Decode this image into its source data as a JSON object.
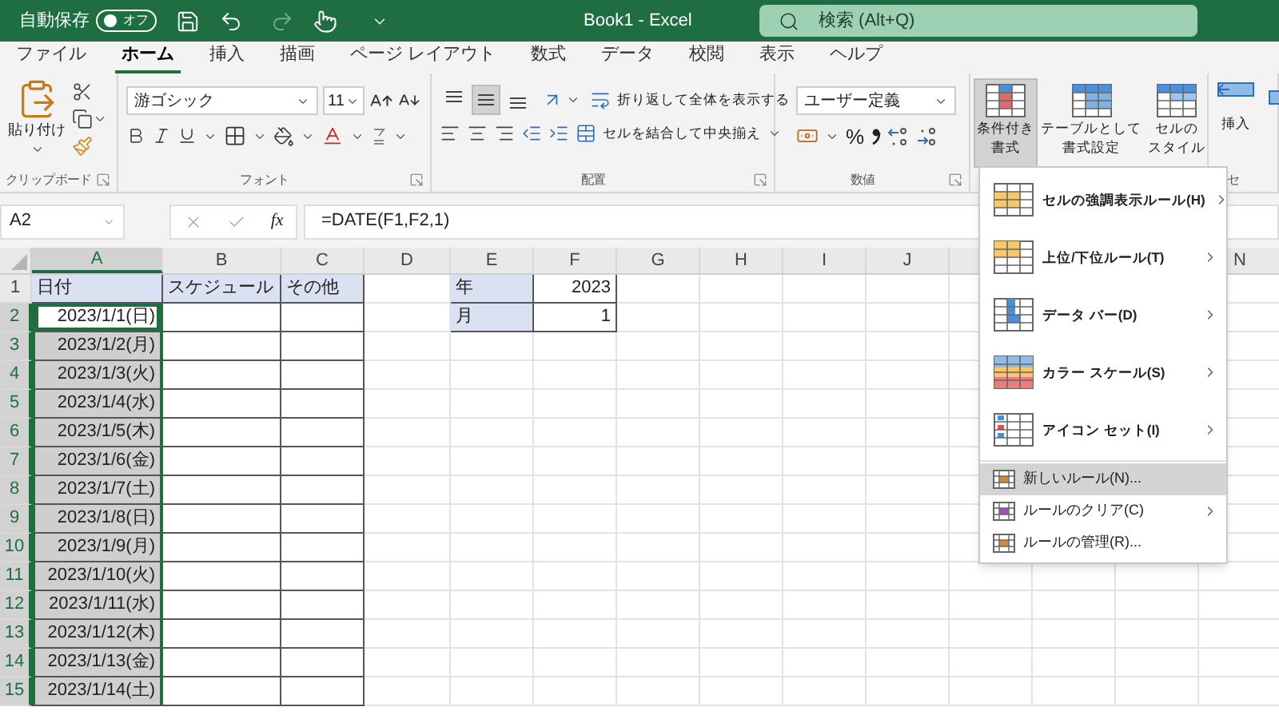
{
  "title_bar": {
    "autosave_label": "自動保存",
    "autosave_toggle": {
      "label": "オフ",
      "on": false
    },
    "title": "Book1 - Excel",
    "search": {
      "placeholder": "検索 (Alt+Q)"
    }
  },
  "tabs": [
    {
      "label": "ファイル",
      "selected": false
    },
    {
      "label": "ホーム",
      "selected": true
    },
    {
      "label": "挿入",
      "selected": false
    },
    {
      "label": "描画",
      "selected": false
    },
    {
      "label": "ページ レイアウト",
      "selected": false
    },
    {
      "label": "数式",
      "selected": false
    },
    {
      "label": "データ",
      "selected": false
    },
    {
      "label": "校閲",
      "selected": false
    },
    {
      "label": "表示",
      "selected": false
    },
    {
      "label": "ヘルプ",
      "selected": false
    }
  ],
  "ribbon": {
    "clipboard": {
      "paste_label": "貼り付け",
      "group_label": "クリップボード"
    },
    "font": {
      "font_name": "游ゴシック",
      "font_size": "11",
      "group_label": "フォント"
    },
    "alignment": {
      "vertical_buttons": [
        {
          "selected": false
        },
        {
          "selected": true
        },
        {
          "selected": false
        }
      ],
      "wrap_label": "折り返して全体を表示する",
      "merge_label": "セルを結合して中央揃え",
      "group_label": "配置"
    },
    "number": {
      "format": "ユーザー定義",
      "percent_label": "%",
      "group_label": "数値"
    },
    "styles": {
      "buttons": [
        {
          "lines": [
            "条件付き",
            "書式"
          ],
          "selected": true
        },
        {
          "lines": [
            "テーブルとして",
            "書式設定"
          ],
          "selected": false
        },
        {
          "lines": [
            "セルの",
            "スタイル"
          ],
          "selected": false
        }
      ]
    },
    "cells": {
      "insert_label": "挿入",
      "group_label": "セ"
    }
  },
  "formula_bar": {
    "name_box": "A2",
    "function_label": "fx",
    "formula": "=DATE(F1,F2,1)"
  },
  "sheet": {
    "columns": [
      {
        "label": "A",
        "selected": true
      },
      {
        "label": "B",
        "selected": false
      },
      {
        "label": "C",
        "selected": false
      },
      {
        "label": "D",
        "selected": false
      },
      {
        "label": "E",
        "selected": false
      },
      {
        "label": "F",
        "selected": false
      },
      {
        "label": "G",
        "selected": false
      },
      {
        "label": "H",
        "selected": false
      },
      {
        "label": "I",
        "selected": false
      },
      {
        "label": "J",
        "selected": false
      }
    ],
    "last_column": {
      "label": "N",
      "selected": false
    },
    "rows": [
      {
        "header": "1",
        "selected": false,
        "cells": [
          {
            "text": "日付",
            "kind": "text",
            "shaded": true,
            "bordered": true,
            "selected": false,
            "active": false
          },
          {
            "text": "スケジュール",
            "kind": "text",
            "shaded": true,
            "bordered": true,
            "selected": false,
            "active": false
          },
          {
            "text": "その他",
            "kind": "text",
            "shaded": true,
            "bordered": true,
            "selected": false,
            "active": false
          },
          {
            "kind": "empty",
            "shaded": false,
            "bordered": false,
            "selected": false,
            "active": false
          },
          {
            "text": "年",
            "kind": "text",
            "shaded": true,
            "bordered": true,
            "selected": false,
            "active": false
          },
          {
            "text": "2023",
            "kind": "number",
            "shaded": false,
            "bordered": true,
            "selected": false,
            "active": false
          }
        ]
      },
      {
        "header": "2",
        "selected": true,
        "cells": [
          {
            "text": "2023/1/1(日)",
            "kind": "number",
            "shaded": false,
            "bordered": true,
            "selected": true,
            "active": true
          },
          {
            "kind": "empty",
            "shaded": false,
            "bordered": true,
            "selected": false,
            "active": false
          },
          {
            "kind": "empty",
            "shaded": false,
            "bordered": true,
            "selected": false,
            "active": false
          },
          {
            "kind": "empty",
            "shaded": false,
            "bordered": false,
            "selected": false,
            "active": false
          },
          {
            "text": "月",
            "kind": "text",
            "shaded": true,
            "bordered": true,
            "selected": false,
            "active": false
          },
          {
            "text": "1",
            "kind": "number",
            "shaded": false,
            "bordered": true,
            "selected": false,
            "active": false
          }
        ]
      },
      {
        "header": "3",
        "selected": true,
        "cells": [
          {
            "text": "2023/1/2(月)",
            "kind": "number",
            "shaded": false,
            "bordered": true,
            "selected": true,
            "active": false
          },
          {
            "kind": "empty",
            "shaded": false,
            "bordered": true,
            "selected": false,
            "active": false
          },
          {
            "kind": "empty",
            "shaded": false,
            "bordered": true,
            "selected": false,
            "active": false
          }
        ]
      },
      {
        "header": "4",
        "selected": true,
        "cells": [
          {
            "text": "2023/1/3(火)",
            "kind": "number",
            "shaded": false,
            "bordered": true,
            "selected": true,
            "active": false
          },
          {
            "kind": "empty",
            "shaded": false,
            "bordered": true,
            "selected": false,
            "active": false
          },
          {
            "kind": "empty",
            "shaded": false,
            "bordered": true,
            "selected": false,
            "active": false
          }
        ]
      },
      {
        "header": "5",
        "selected": true,
        "cells": [
          {
            "text": "2023/1/4(水)",
            "kind": "number",
            "shaded": false,
            "bordered": true,
            "selected": true,
            "active": false
          },
          {
            "kind": "empty",
            "shaded": false,
            "bordered": true,
            "selected": false,
            "active": false
          },
          {
            "kind": "empty",
            "shaded": false,
            "bordered": true,
            "selected": false,
            "active": false
          }
        ]
      },
      {
        "header": "6",
        "selected": true,
        "cells": [
          {
            "text": "2023/1/5(木)",
            "kind": "number",
            "shaded": false,
            "bordered": true,
            "selected": true,
            "active": false
          },
          {
            "kind": "empty",
            "shaded": false,
            "bordered": true,
            "selected": false,
            "active": false
          },
          {
            "kind": "empty",
            "shaded": false,
            "bordered": true,
            "selected": false,
            "active": false
          }
        ]
      },
      {
        "header": "7",
        "selected": true,
        "cells": [
          {
            "text": "2023/1/6(金)",
            "kind": "number",
            "shaded": false,
            "bordered": true,
            "selected": true,
            "active": false
          },
          {
            "kind": "empty",
            "shaded": false,
            "bordered": true,
            "selected": false,
            "active": false
          },
          {
            "kind": "empty",
            "shaded": false,
            "bordered": true,
            "selected": false,
            "active": false
          }
        ]
      },
      {
        "header": "8",
        "selected": true,
        "cells": [
          {
            "text": "2023/1/7(土)",
            "kind": "number",
            "shaded": false,
            "bordered": true,
            "selected": true,
            "active": false
          },
          {
            "kind": "empty",
            "shaded": false,
            "bordered": true,
            "selected": false,
            "active": false
          },
          {
            "kind": "empty",
            "shaded": false,
            "bordered": true,
            "selected": false,
            "active": false
          }
        ]
      },
      {
        "header": "9",
        "selected": true,
        "cells": [
          {
            "text": "2023/1/8(日)",
            "kind": "number",
            "shaded": false,
            "bordered": true,
            "selected": true,
            "active": false
          },
          {
            "kind": "empty",
            "shaded": false,
            "bordered": true,
            "selected": false,
            "active": false
          },
          {
            "kind": "empty",
            "shaded": false,
            "bordered": true,
            "selected": false,
            "active": false
          }
        ]
      },
      {
        "header": "10",
        "selected": true,
        "cells": [
          {
            "text": "2023/1/9(月)",
            "kind": "number",
            "shaded": false,
            "bordered": true,
            "selected": true,
            "active": false
          },
          {
            "kind": "empty",
            "shaded": false,
            "bordered": true,
            "selected": false,
            "active": false
          },
          {
            "kind": "empty",
            "shaded": false,
            "bordered": true,
            "selected": false,
            "active": false
          }
        ]
      },
      {
        "header": "11",
        "selected": true,
        "cells": [
          {
            "text": "2023/1/10(火)",
            "kind": "number",
            "shaded": false,
            "bordered": true,
            "selected": true,
            "active": false
          },
          {
            "kind": "empty",
            "shaded": false,
            "bordered": true,
            "selected": false,
            "active": false
          },
          {
            "kind": "empty",
            "shaded": false,
            "bordered": true,
            "selected": false,
            "active": false
          }
        ]
      },
      {
        "header": "12",
        "selected": true,
        "cells": [
          {
            "text": "2023/1/11(水)",
            "kind": "number",
            "shaded": false,
            "bordered": true,
            "selected": true,
            "active": false
          },
          {
            "kind": "empty",
            "shaded": false,
            "bordered": true,
            "selected": false,
            "active": false
          },
          {
            "kind": "empty",
            "shaded": false,
            "bordered": true,
            "selected": false,
            "active": false
          }
        ]
      },
      {
        "header": "13",
        "selected": true,
        "cells": [
          {
            "text": "2023/1/12(木)",
            "kind": "number",
            "shaded": false,
            "bordered": true,
            "selected": true,
            "active": false
          },
          {
            "kind": "empty",
            "shaded": false,
            "bordered": true,
            "selected": false,
            "active": false
          },
          {
            "kind": "empty",
            "shaded": false,
            "bordered": true,
            "selected": false,
            "active": false
          }
        ]
      },
      {
        "header": "14",
        "selected": true,
        "cells": [
          {
            "text": "2023/1/13(金)",
            "kind": "number",
            "shaded": false,
            "bordered": true,
            "selected": true,
            "active": false
          },
          {
            "kind": "empty",
            "shaded": false,
            "bordered": true,
            "selected": false,
            "active": false
          },
          {
            "kind": "empty",
            "shaded": false,
            "bordered": true,
            "selected": false,
            "active": false
          }
        ]
      },
      {
        "header": "15",
        "selected": true,
        "cells": [
          {
            "text": "2023/1/14(土)",
            "kind": "number",
            "shaded": false,
            "bordered": true,
            "selected": true,
            "active": false
          },
          {
            "kind": "empty",
            "shaded": false,
            "bordered": true,
            "selected": false,
            "active": false
          },
          {
            "kind": "empty",
            "shaded": false,
            "bordered": true,
            "selected": false,
            "active": false
          }
        ]
      }
    ]
  },
  "menu": {
    "items": [
      {
        "label": "セルの強調表示ルール(H)",
        "kind": "large",
        "submenu": true,
        "selected": false
      },
      {
        "label": "上位/下位ルール(T)",
        "kind": "large",
        "submenu": true,
        "selected": false
      },
      {
        "label": "データ バー(D)",
        "kind": "large",
        "submenu": true,
        "selected": false
      },
      {
        "label": "カラー スケール(S)",
        "kind": "large",
        "submenu": true,
        "selected": false
      },
      {
        "label": "アイコン セット(I)",
        "kind": "large",
        "submenu": true,
        "selected": false
      },
      {
        "label": "新しいルール(N)...",
        "kind": "small",
        "submenu": false,
        "selected": true
      },
      {
        "label": "ルールのクリア(C)",
        "kind": "small",
        "submenu": true,
        "selected": false
      },
      {
        "label": "ルールの管理(R)...",
        "kind": "small",
        "submenu": false,
        "selected": false
      }
    ]
  }
}
